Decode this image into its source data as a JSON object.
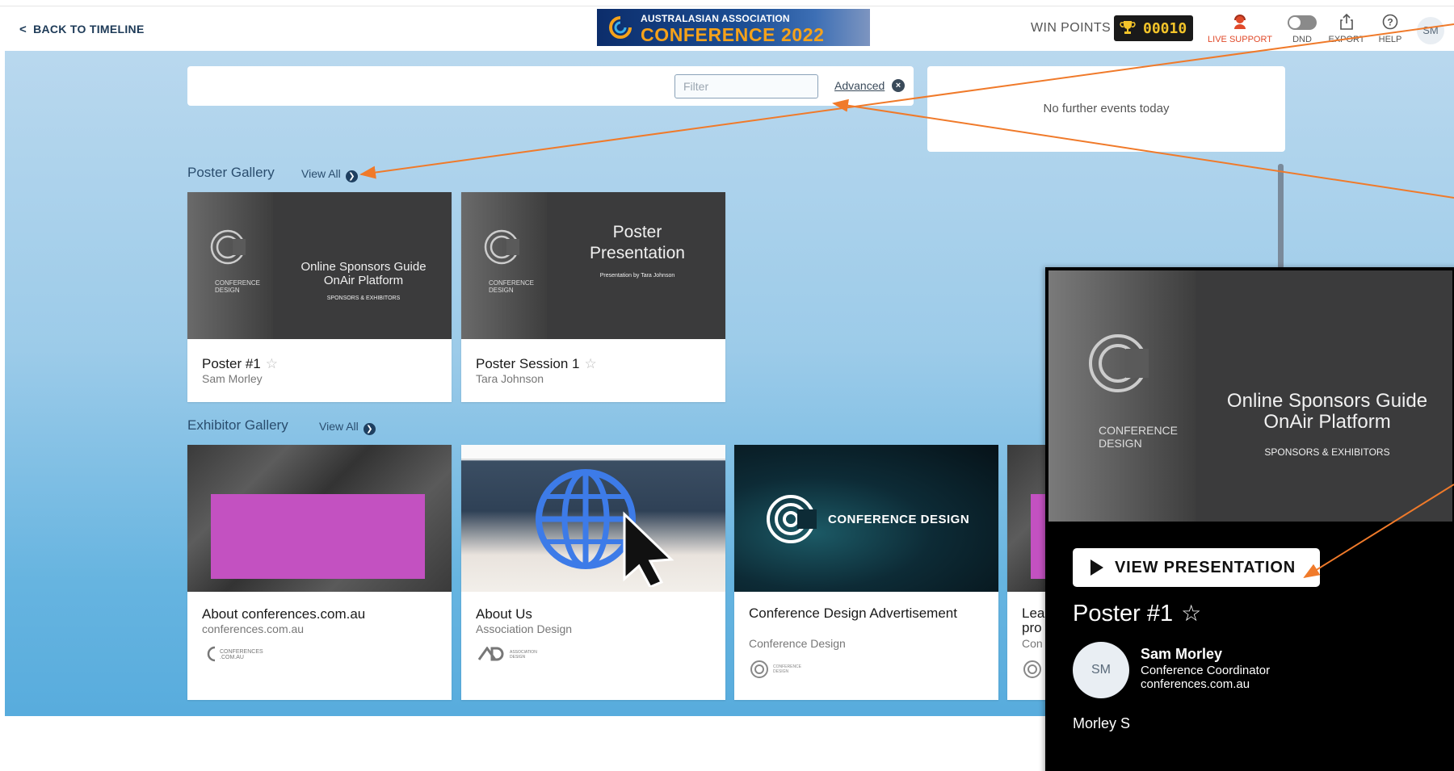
{
  "header": {
    "back_label": "BACK TO TIMELINE",
    "banner_line1": "AUSTRALASIAN ASSOCIATION",
    "banner_line2": "CONFERENCE 2022",
    "win_points_label": "WIN POINTS",
    "win_points_value": "00010",
    "live_support": "LIVE SUPPORT",
    "dnd": "DND",
    "export": "EXPORT",
    "help": "HELP",
    "avatar_initials": "SM"
  },
  "filter": {
    "placeholder": "Filter",
    "advanced": "Advanced"
  },
  "events": {
    "message": "No further events today"
  },
  "poster_gallery": {
    "title": "Poster Gallery",
    "view_all": "View All",
    "items": [
      {
        "thumb_line1": "Online Sponsors Guide",
        "thumb_line2": "OnAir Platform",
        "thumb_line3": "SPONSORS & EXHIBITORS",
        "thumb_logo_text": "CONFERENCE\nDESIGN",
        "title": "Poster #1",
        "subtitle": "Sam Morley"
      },
      {
        "thumb_line1": "Poster",
        "thumb_line2": "Presentation",
        "thumb_line3": "Presentation by Tara Johnson",
        "thumb_logo_text": "CONFERENCE\nDESIGN",
        "title": "Poster Session 1",
        "subtitle": "Tara Johnson"
      }
    ]
  },
  "exhibitor_gallery": {
    "title": "Exhibitor Gallery",
    "view_all": "View All",
    "items": [
      {
        "title": "About conferences.com.au",
        "subtitle": "conferences.com.au",
        "logo": "CONFERENCES .COM.AU"
      },
      {
        "title": "About Us",
        "subtitle": "Association Design",
        "logo": "ASSOCIATION DESIGN"
      },
      {
        "title": "Conference Design Advertisement",
        "subtitle": "Conference Design",
        "logo": "CONFERENCE DESIGN",
        "thumb_text": "CONFERENCE DESIGN"
      },
      {
        "title_line1": "Lea",
        "title_line2": "pro",
        "subtitle": "Con"
      }
    ]
  },
  "overlay": {
    "thumb_line1": "Online Sponsors Guide",
    "thumb_line2": "OnAir Platform",
    "thumb_line3": "SPONSORS & EXHIBITORS",
    "thumb_logo_text": "CONFERENCE\nDESIGN",
    "view_button": "VIEW PRESENTATION",
    "title": "Poster #1",
    "avatar_initials": "SM",
    "presenter_name": "Sam Morley",
    "presenter_role": "Conference Coordinator",
    "presenter_org": "conferences.com.au",
    "footer_name": "Morley S"
  },
  "colors": {
    "accent": "#f07a2a",
    "brand_navy": "#1d3a57",
    "win_gold": "#f3c42a",
    "live_red": "#e04a2a",
    "magenta": "#c351c1"
  }
}
